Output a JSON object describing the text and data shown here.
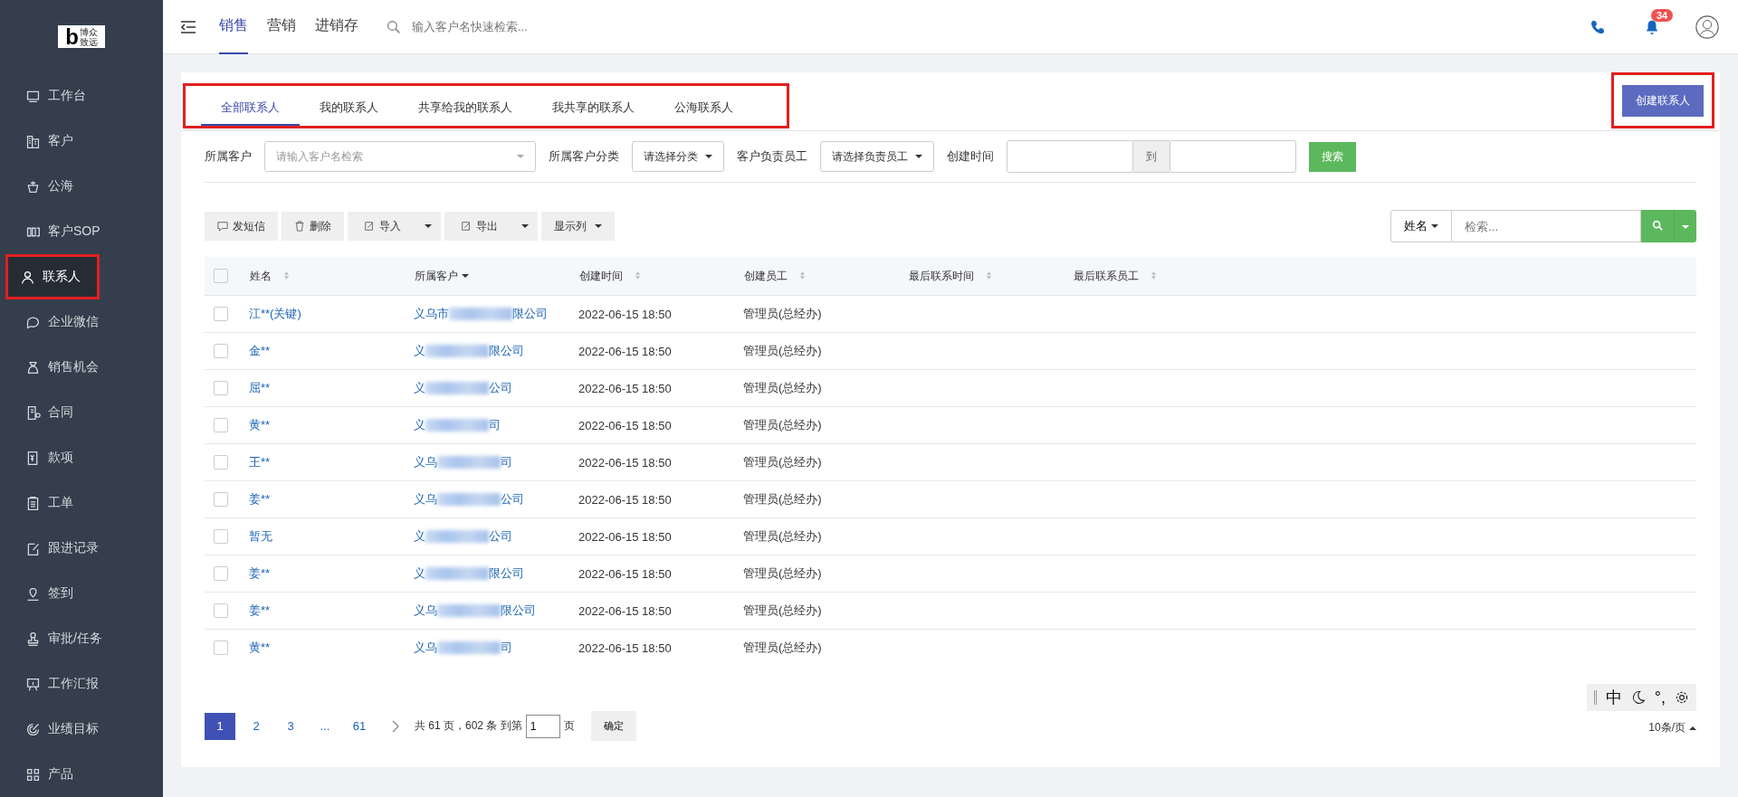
{
  "logo": {
    "mark": "b",
    "lines": [
      "博众",
      "致远"
    ]
  },
  "sidebar": {
    "items": [
      {
        "label": "工作台",
        "selected": false,
        "highlighted": false
      },
      {
        "label": "客户",
        "selected": false,
        "highlighted": false
      },
      {
        "label": "公海",
        "selected": false,
        "highlighted": false
      },
      {
        "label": "客户SOP",
        "selected": false,
        "highlighted": false
      },
      {
        "label": "联系人",
        "selected": true,
        "highlighted": true
      },
      {
        "label": "企业微信",
        "selected": false,
        "highlighted": false
      },
      {
        "label": "销售机会",
        "selected": false,
        "highlighted": false
      },
      {
        "label": "合同",
        "selected": false,
        "highlighted": false
      },
      {
        "label": "款项",
        "selected": false,
        "highlighted": false
      },
      {
        "label": "工单",
        "selected": false,
        "highlighted": false
      },
      {
        "label": "跟进记录",
        "selected": false,
        "highlighted": false
      },
      {
        "label": "签到",
        "selected": false,
        "highlighted": false
      },
      {
        "label": "审批/任务",
        "selected": false,
        "highlighted": false
      },
      {
        "label": "工作汇报",
        "selected": false,
        "highlighted": false
      },
      {
        "label": "业绩目标",
        "selected": false,
        "highlighted": false
      },
      {
        "label": "产品",
        "selected": false,
        "highlighted": false
      }
    ]
  },
  "topbar": {
    "tabs": [
      {
        "label": "销售",
        "selected": true
      },
      {
        "label": "营销",
        "selected": false
      },
      {
        "label": "进销存",
        "selected": false
      }
    ],
    "search": {
      "placeholder": "输入客户名快速检索..."
    },
    "notifications": "34"
  },
  "contact_tabs": {
    "highlighted": true,
    "tabs": [
      {
        "label": "全部联系人",
        "selected": true
      },
      {
        "label": "我的联系人",
        "selected": false
      },
      {
        "label": "共享给我的联系人",
        "selected": false
      },
      {
        "label": "我共享的联系人",
        "selected": false
      },
      {
        "label": "公海联系人",
        "selected": false
      }
    ]
  },
  "create_button": {
    "label": "创建联系人",
    "highlighted": true
  },
  "filters": {
    "customer_label": "所属客户",
    "customer_placeholder": "请输入客户名检索",
    "category_label": "所属客户分类",
    "category_value": "请选择分类",
    "owner_label": "客户负责员工",
    "owner_value": "请选择负责员工",
    "time_label": "创建时间",
    "time_separator": "到",
    "search_button": "搜索"
  },
  "toolbar": {
    "buttons": [
      {
        "label": "发短信",
        "kind": "plain"
      },
      {
        "label": "删除",
        "kind": "plain"
      },
      {
        "label": "导入",
        "kind": "split"
      },
      {
        "label": "导出",
        "kind": "split"
      },
      {
        "label": "显示列",
        "kind": "dropdown"
      }
    ],
    "search_field": "姓名",
    "search_placeholder": "检索..."
  },
  "table": {
    "all_checked": false,
    "columns": [
      "姓名",
      "所属客户",
      "创建时间",
      "创建员工",
      "最后联系时间",
      "最后联系员工"
    ],
    "rows": [
      {
        "name": "江**(关键)",
        "customer_start": "义乌市",
        "customer_end": "限公司",
        "created": "2022-06-15 18:50",
        "creator": "管理员(总经办)",
        "checked": false
      },
      {
        "name": "金**",
        "customer_start": "义",
        "customer_end": "限公司",
        "created": "2022-06-15 18:50",
        "creator": "管理员(总经办)",
        "checked": false
      },
      {
        "name": "屈**",
        "customer_start": "义",
        "customer_end": "公司",
        "created": "2022-06-15 18:50",
        "creator": "管理员(总经办)",
        "checked": false
      },
      {
        "name": "黄**",
        "customer_start": "义",
        "customer_end": "司",
        "created": "2022-06-15 18:50",
        "creator": "管理员(总经办)",
        "checked": false
      },
      {
        "name": "王**",
        "customer_start": "义乌",
        "customer_end": "司",
        "created": "2022-06-15 18:50",
        "creator": "管理员(总经办)",
        "checked": false
      },
      {
        "name": "姜**",
        "customer_start": "义乌",
        "customer_end": "公司",
        "created": "2022-06-15 18:50",
        "creator": "管理员(总经办)",
        "checked": false
      },
      {
        "name": "暂无",
        "customer_start": "义",
        "customer_end": "公司",
        "created": "2022-06-15 18:50",
        "creator": "管理员(总经办)",
        "checked": false
      },
      {
        "name": "姜**",
        "customer_start": "义",
        "customer_end": "限公司",
        "created": "2022-06-15 18:50",
        "creator": "管理员(总经办)",
        "checked": false
      },
      {
        "name": "姜**",
        "customer_start": "义乌",
        "customer_end": "限公司",
        "created": "2022-06-15 18:50",
        "creator": "管理员(总经办)",
        "checked": false
      },
      {
        "name": "黄**",
        "customer_start": "义乌",
        "customer_end": "司",
        "created": "2022-06-15 18:50",
        "creator": "管理员(总经办)",
        "checked": false
      }
    ]
  },
  "pagination": {
    "pages": [
      {
        "label": "1",
        "selected": true
      },
      {
        "label": "2",
        "selected": false
      },
      {
        "label": "3",
        "selected": false
      },
      {
        "label": "...",
        "selected": false
      },
      {
        "label": "61",
        "selected": false
      }
    ],
    "summary": "共 61 页，602 条 到第",
    "page_input": "1",
    "page_suffix": "页",
    "confirm": "确定",
    "page_size": "10条/页"
  },
  "ime_toolbar": {
    "mode": "中",
    "punctuation": "°,"
  }
}
